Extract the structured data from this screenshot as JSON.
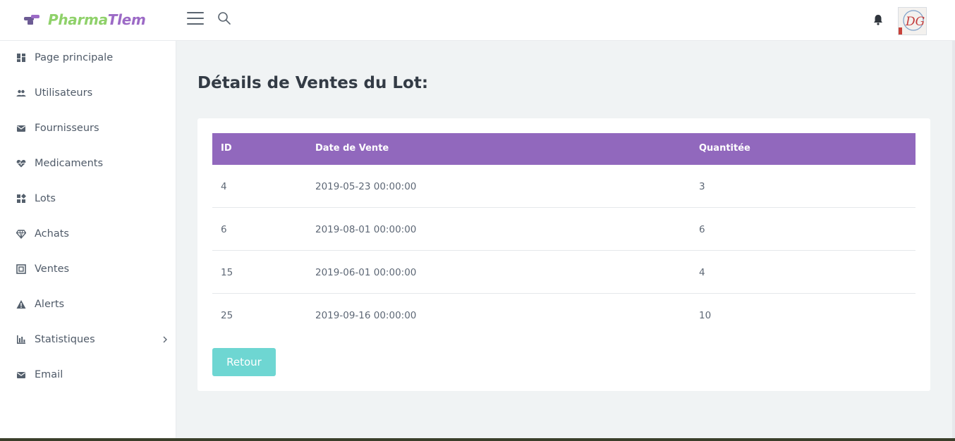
{
  "brand": {
    "part1": "Pharma",
    "part2": "Tlem",
    "color1": "#8fd16a",
    "color2": "#9c6ac6"
  },
  "header": {
    "menu_icon": "hamburger-icon",
    "search_icon": "search-icon",
    "notification_icon": "bell-icon",
    "avatar_text": "DG"
  },
  "sidebar": {
    "items": [
      {
        "label": "Page principale",
        "icon": "dashboard-icon"
      },
      {
        "label": "Utilisateurs",
        "icon": "users-icon"
      },
      {
        "label": "Fournisseurs",
        "icon": "envelope-icon"
      },
      {
        "label": "Medicaments",
        "icon": "heart-pulse-icon"
      },
      {
        "label": "Lots",
        "icon": "blocks-icon"
      },
      {
        "label": "Achats",
        "icon": "diamond-icon"
      },
      {
        "label": "Ventes",
        "icon": "register-icon"
      },
      {
        "label": "Alerts",
        "icon": "warning-icon"
      },
      {
        "label": "Statistiques",
        "icon": "bar-chart-icon",
        "has_submenu": true
      },
      {
        "label": "Email",
        "icon": "envelope-icon"
      }
    ]
  },
  "main": {
    "title": "Détails de Ventes du Lot:",
    "table": {
      "headers": [
        "ID",
        "Date de Vente",
        "Quantitée"
      ],
      "header_color": "#9168bd",
      "rows": [
        [
          "4",
          "2019-05-23 00:00:00",
          "3"
        ],
        [
          "6",
          "2019-08-01 00:00:00",
          "6"
        ],
        [
          "15",
          "2019-06-01 00:00:00",
          "4"
        ],
        [
          "25",
          "2019-09-16 00:00:00",
          "10"
        ]
      ]
    },
    "back_button": "Retour",
    "back_button_color": "#6ed6d2"
  }
}
